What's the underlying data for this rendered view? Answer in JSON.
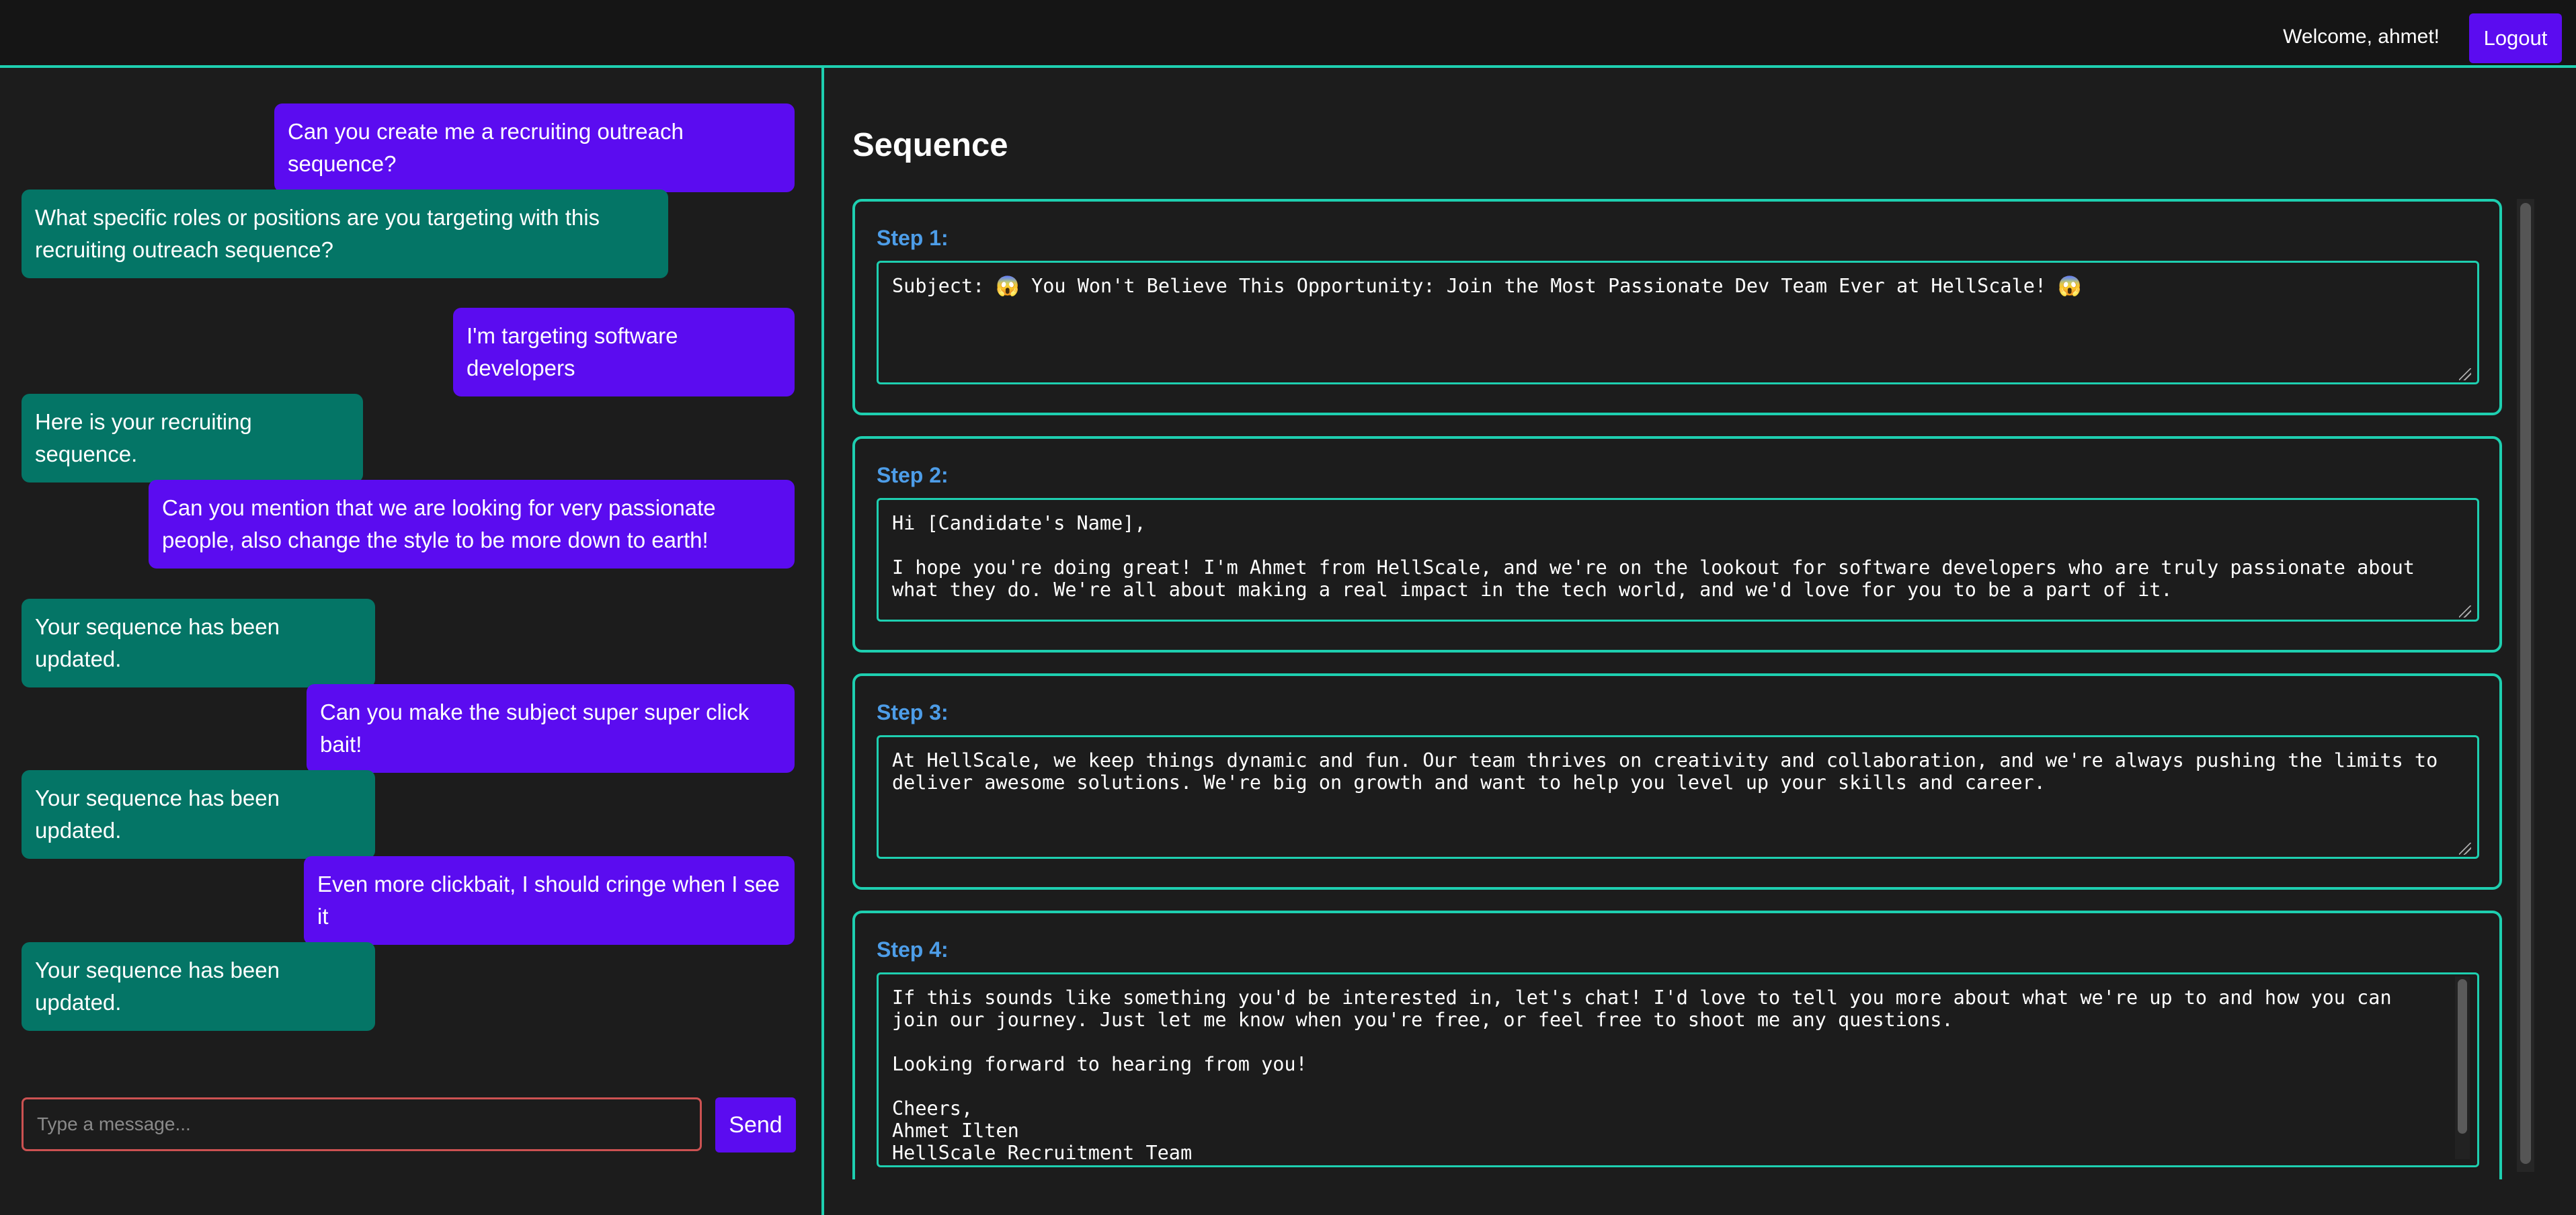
{
  "header": {
    "welcome": "Welcome, ahmet!",
    "logout": "Logout"
  },
  "chat": {
    "messages": [
      {
        "role": "user",
        "text": "Can you create me a recruiting outreach sequence?"
      },
      {
        "role": "bot",
        "text": "What specific roles or positions are you targeting with this recruiting outreach sequence?"
      },
      {
        "role": "user",
        "text": "I'm targeting software developers"
      },
      {
        "role": "bot",
        "text": "Here is your recruiting sequence."
      },
      {
        "role": "user",
        "text": "Can you mention that we are looking for very passionate people, also change the style to be more down to earth!"
      },
      {
        "role": "bot",
        "text": "Your sequence has been updated."
      },
      {
        "role": "user",
        "text": "Can you make the subject super super click bait!"
      },
      {
        "role": "bot",
        "text": "Your sequence has been updated."
      },
      {
        "role": "user",
        "text": "Even more clickbait, I should cringe when I see it"
      },
      {
        "role": "bot",
        "text": "Your sequence has been updated."
      }
    ],
    "input_placeholder": "Type a message...",
    "input_value": "",
    "send": "Send"
  },
  "sequence": {
    "title": "Sequence",
    "steps": [
      {
        "label": "Step 1:",
        "text": "Subject: 😱 You Won't Believe This Opportunity: Join the Most Passionate Dev Team Ever at HellScale! 😱"
      },
      {
        "label": "Step 2:",
        "text": "Hi [Candidate's Name],\n\nI hope you're doing great! I'm Ahmet from HellScale, and we're on the lookout for software developers who are truly passionate about what they do. We're all about making a real impact in the tech world, and we'd love for you to be a part of it."
      },
      {
        "label": "Step 3:",
        "text": "At HellScale, we keep things dynamic and fun. Our team thrives on creativity and collaboration, and we're always pushing the limits to deliver awesome solutions. We're big on growth and want to help you level up your skills and career."
      },
      {
        "label": "Step 4:",
        "text": "If this sounds like something you'd be interested in, let's chat! I'd love to tell you more about what we're up to and how you can join our journey. Just let me know when you're free, or feel free to shoot me any questions.\n\nLooking forward to hearing from you!\n\nCheers,\nAhmet Ilten\nHellScale Recruitment Team"
      }
    ]
  }
}
